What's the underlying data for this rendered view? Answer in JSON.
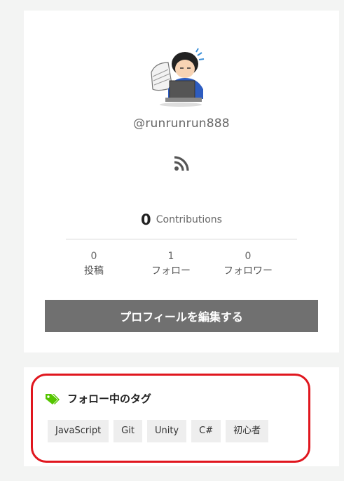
{
  "profile": {
    "username": "@runrunrun888",
    "avatar_icon": "user-avatar-illustration",
    "feed_icon": "rss-icon",
    "contributions": {
      "count": "0",
      "label": "Contributions"
    },
    "stats": [
      {
        "count": "0",
        "label": "投稿"
      },
      {
        "count": "1",
        "label": "フォロー"
      },
      {
        "count": "0",
        "label": "フォロワー"
      }
    ],
    "edit_button_label": "プロフィールを編集する"
  },
  "followed_tags": {
    "title": "フォロー中のタグ",
    "icon": "tags-icon",
    "icon_color": "#55c500",
    "highlight_color": "#e0161e",
    "tags": [
      "JavaScript",
      "Git",
      "Unity",
      "C#",
      "初心者"
    ]
  }
}
